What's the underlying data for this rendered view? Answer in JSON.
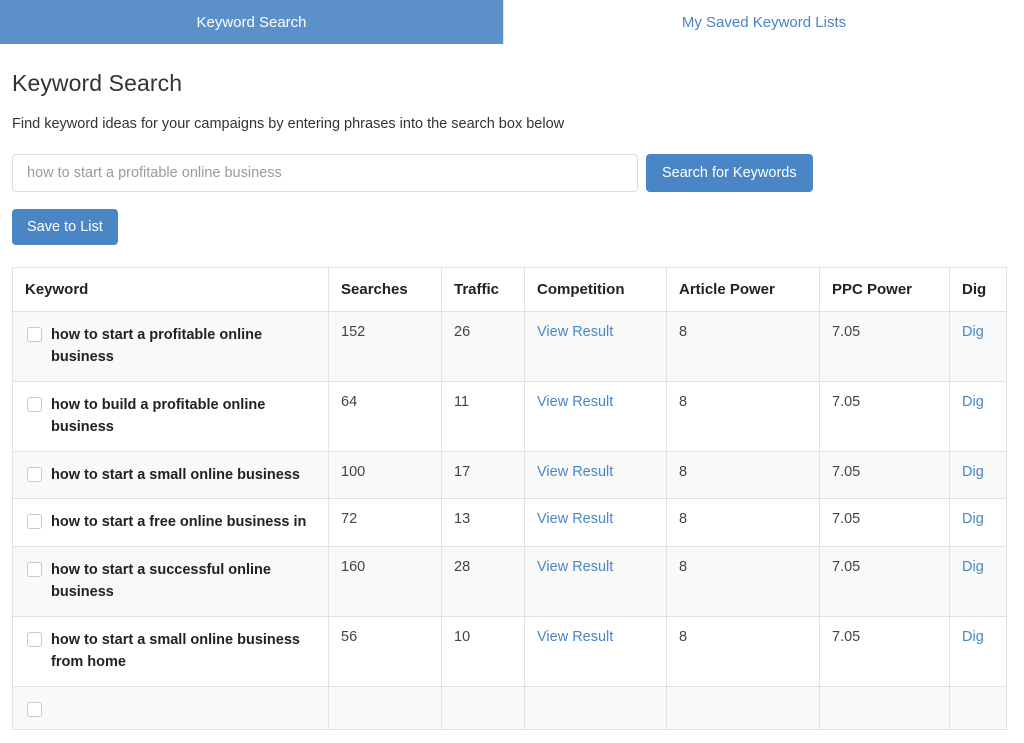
{
  "tabs": [
    {
      "label": "Keyword Search",
      "active": true
    },
    {
      "label": "My Saved Keyword Lists",
      "active": false
    }
  ],
  "header": {
    "title": "Keyword Search",
    "subtitle": "Find keyword ideas for your campaigns by entering phrases into the search box below"
  },
  "search": {
    "value": "",
    "placeholder": "how to start a profitable online business",
    "search_button": "Search for Keywords",
    "save_button": "Save to List"
  },
  "table": {
    "columns": [
      "Keyword",
      "Searches",
      "Traffic",
      "Competition",
      "Article Power",
      "PPC Power",
      "Dig"
    ],
    "rows": [
      {
        "keyword": "how to start a profitable online business",
        "searches": "152",
        "traffic": "26",
        "competition": "View Result",
        "article_power": "8",
        "ppc_power": "7.05",
        "dig": "Dig"
      },
      {
        "keyword": "how to build a profitable online business",
        "searches": "64",
        "traffic": "11",
        "competition": "View Result",
        "article_power": "8",
        "ppc_power": "7.05",
        "dig": "Dig"
      },
      {
        "keyword": "how to start a small online business",
        "searches": "100",
        "traffic": "17",
        "competition": "View Result",
        "article_power": "8",
        "ppc_power": "7.05",
        "dig": "Dig"
      },
      {
        "keyword": "how to start a free online business in",
        "searches": "72",
        "traffic": "13",
        "competition": "View Result",
        "article_power": "8",
        "ppc_power": "7.05",
        "dig": "Dig"
      },
      {
        "keyword": "how to start a successful online business",
        "searches": "160",
        "traffic": "28",
        "competition": "View Result",
        "article_power": "8",
        "ppc_power": "7.05",
        "dig": "Dig"
      },
      {
        "keyword": "how to start a small online business from home",
        "searches": "56",
        "traffic": "10",
        "competition": "View Result",
        "article_power": "8",
        "ppc_power": "7.05",
        "dig": "Dig"
      },
      {
        "keyword": "",
        "searches": "",
        "traffic": "",
        "competition": "",
        "article_power": "",
        "ppc_power": "",
        "dig": ""
      }
    ]
  },
  "colors": {
    "accent": "#4a86c5",
    "tab_active": "#5b90c8",
    "link": "#4a86c5",
    "row_stripe": "#f9f9f9"
  }
}
